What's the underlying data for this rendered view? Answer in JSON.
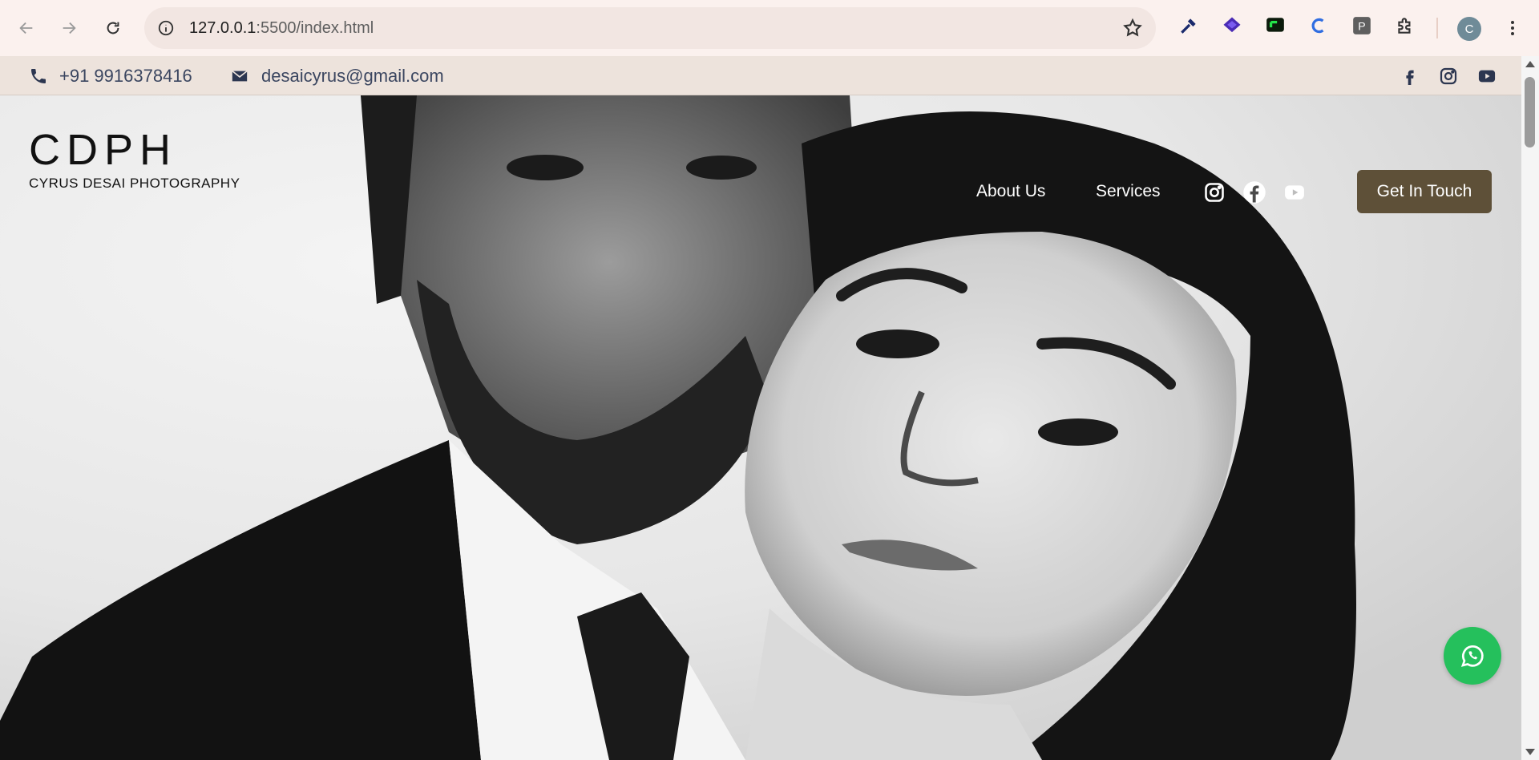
{
  "browser": {
    "url_host": "127.0.0.1",
    "url_rest": ":5500/index.html",
    "profile_initial": "C"
  },
  "topbar": {
    "phone": "+91 9916378416",
    "email": "desaicyrus@gmail.com"
  },
  "brand": {
    "title": "CDPH",
    "subtitle": "CYRUS DESAI PHOTOGRAPHY"
  },
  "nav": {
    "about": "About Us",
    "services": "Services",
    "cta": "Get In Touch"
  },
  "colors": {
    "cta": "#5e5038",
    "whatsapp": "#25c05c",
    "topbar": "#ede3dc"
  }
}
